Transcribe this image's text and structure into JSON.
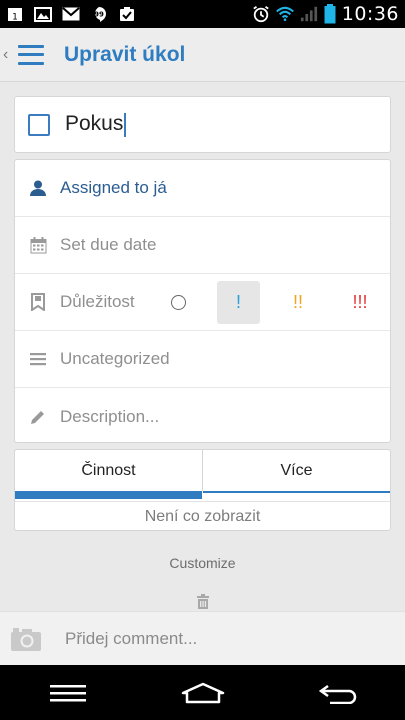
{
  "status_bar": {
    "time": "10:36",
    "left_icons": [
      "calendar-icon",
      "gallery-icon",
      "gmail-icon",
      "hangouts-icon",
      "task-icon"
    ],
    "right_icons": [
      "alarm-icon",
      "wifi-icon",
      "signal-icon",
      "battery-icon"
    ]
  },
  "appbar": {
    "back_glyph": "‹",
    "title": "Upravit úkol"
  },
  "task": {
    "name": "Pokus",
    "checked": false
  },
  "properties": {
    "assigned": "Assigned to já",
    "due_date": "Set due date",
    "importance_label": "Důležitost",
    "importance_options": [
      "○",
      "!",
      "!!",
      "!!!"
    ],
    "importance_selected": "!",
    "category": "Uncategorized",
    "description_placeholder": "Description..."
  },
  "tabs": {
    "items": [
      "Činnost",
      "Více"
    ],
    "active": "Činnost",
    "empty_text": "Není co zobrazit"
  },
  "customize_label": "Customize",
  "comment": {
    "placeholder": "Přidej comment..."
  },
  "colors": {
    "accent": "#2f7cc1",
    "priority_low": "#2aa0d8",
    "priority_medium": "#f1a41e",
    "priority_high": "#e43b3b"
  }
}
